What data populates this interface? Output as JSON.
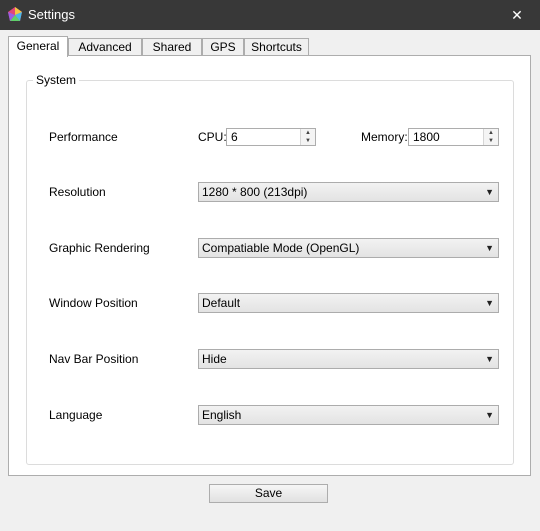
{
  "window": {
    "title": "Settings",
    "close_glyph": "✕",
    "icon": "app-logo-icon"
  },
  "tabs": [
    {
      "label": "General",
      "active": true
    },
    {
      "label": "Advanced",
      "active": false
    },
    {
      "label": "Shared",
      "active": false
    },
    {
      "label": "GPS",
      "active": false
    },
    {
      "label": "Shortcuts",
      "active": false
    }
  ],
  "system": {
    "group_title": "System",
    "performance": {
      "label": "Performance",
      "cpu_label": "CPU:",
      "cpu_value": "6",
      "memory_label": "Memory:",
      "memory_value": "1800"
    },
    "resolution": {
      "label": "Resolution",
      "value": "1280 * 800 (213dpi)"
    },
    "rendering": {
      "label": "Graphic Rendering",
      "value": "Compatiable Mode (OpenGL)"
    },
    "window_position": {
      "label": "Window Position",
      "value": "Default"
    },
    "nav_bar_position": {
      "label": "Nav Bar Position",
      "value": "Hide"
    },
    "language": {
      "label": "Language",
      "value": "English"
    }
  },
  "save_label": "Save",
  "colors": {
    "titlebar": "#383838",
    "panel": "#ffffff",
    "background": "#f0f0f0"
  }
}
